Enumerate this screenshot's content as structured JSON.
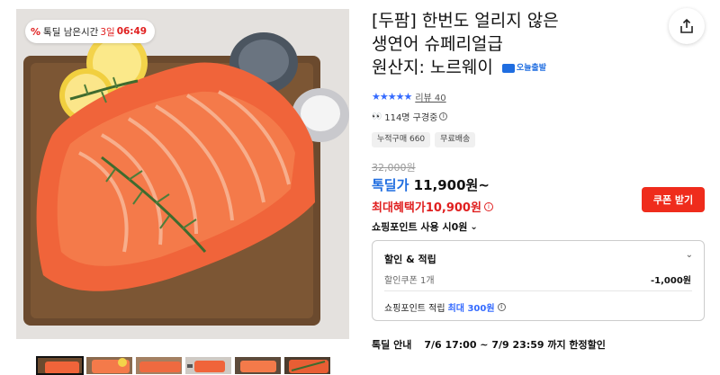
{
  "deal_badge": {
    "percent_icon": "%",
    "label": "톡딜 남은시간",
    "days": "3일",
    "time": "06:49"
  },
  "product": {
    "title_line1": "[두팜] 한번도 얼리지 않은",
    "title_line2": "생연어 슈페리얼급",
    "title_line3": "원산지: 노르웨이",
    "delivery_tag": "오늘출발"
  },
  "rating": {
    "stars": "★★★★★",
    "stars_filled": 5,
    "review_label": "리뷰 40"
  },
  "viewers": {
    "eyes": "👀",
    "text": "114명 구경중"
  },
  "chips": [
    "누적구매 660",
    "무료배송"
  ],
  "price": {
    "original": "32,000원",
    "deal_label": "톡딜가",
    "deal_value": "11,900원~",
    "max_label": "최대혜택가",
    "max_value": "10,900원"
  },
  "coupon_button": "쿠폰 받기",
  "points_use": "쇼핑포인트 사용 시0원",
  "benefits": {
    "header": "할인 & 적립",
    "coupon_label": "할인쿠폰 1개",
    "coupon_amount": "-1,000원",
    "points_label": "쇼핑포인트 적립",
    "points_max_label": "최대 300원"
  },
  "deal_period": {
    "label": "톡딜 안내",
    "value": "7/6 17:00 ~ 7/9 23:59 까지 한정할인"
  },
  "colors": {
    "accent_blue": "#1f6de0",
    "accent_red": "#e02020",
    "coupon_red": "#ef2c1c"
  },
  "icons": {
    "share": "share-icon",
    "chevron": "chevron-down-icon",
    "info": "info-icon"
  }
}
